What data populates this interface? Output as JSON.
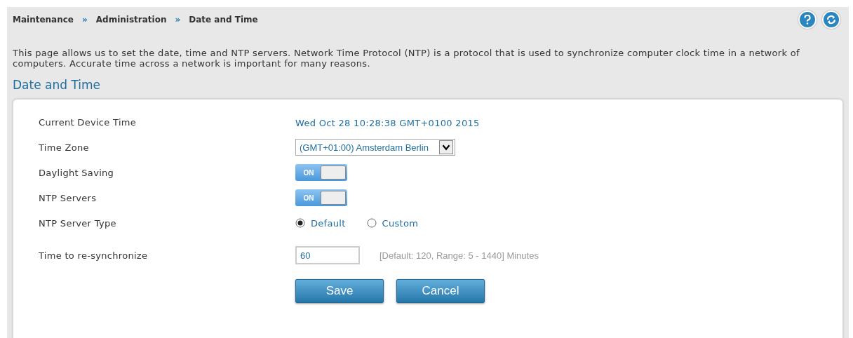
{
  "breadcrumb": [
    {
      "kind": "link",
      "text": "Maintenance"
    },
    {
      "kind": "separator",
      "text": "»"
    },
    {
      "kind": "link",
      "text": "Administration"
    },
    {
      "kind": "separator",
      "text": "»"
    },
    {
      "kind": "current",
      "text": "Date and Time"
    }
  ],
  "description": "This page allows us to set the date, time and NTP servers. Network Time Protocol (NTP) is a protocol that is used to synchronize computer clock time in a network of computers. Accurate time across a network is important for many reasons.",
  "section_title": "Date and Time",
  "fields": [
    {
      "kind": "text",
      "label": "Current Device Time",
      "value": "Wed Oct 28 10:28:38 GMT+0100 2015"
    },
    {
      "kind": "select",
      "label": "Time Zone",
      "value": "(GMT+01:00) Amsterdam Berlin"
    },
    {
      "kind": "toggle",
      "label": "Daylight Saving",
      "on": true,
      "on_text": "ON"
    },
    {
      "kind": "toggle",
      "label": "NTP Servers",
      "on": true,
      "on_text": "ON"
    },
    {
      "kind": "radio",
      "label": "NTP Server Type",
      "options": [
        {
          "label": "Default",
          "selected": true
        },
        {
          "label": "Custom",
          "selected": false
        }
      ]
    },
    {
      "kind": "input",
      "label": "Time to re-synchronize",
      "value": "60",
      "hint": "[Default: 120, Range: 5 - 1440] Minutes"
    }
  ],
  "buttons": [
    "Save",
    "Cancel"
  ]
}
